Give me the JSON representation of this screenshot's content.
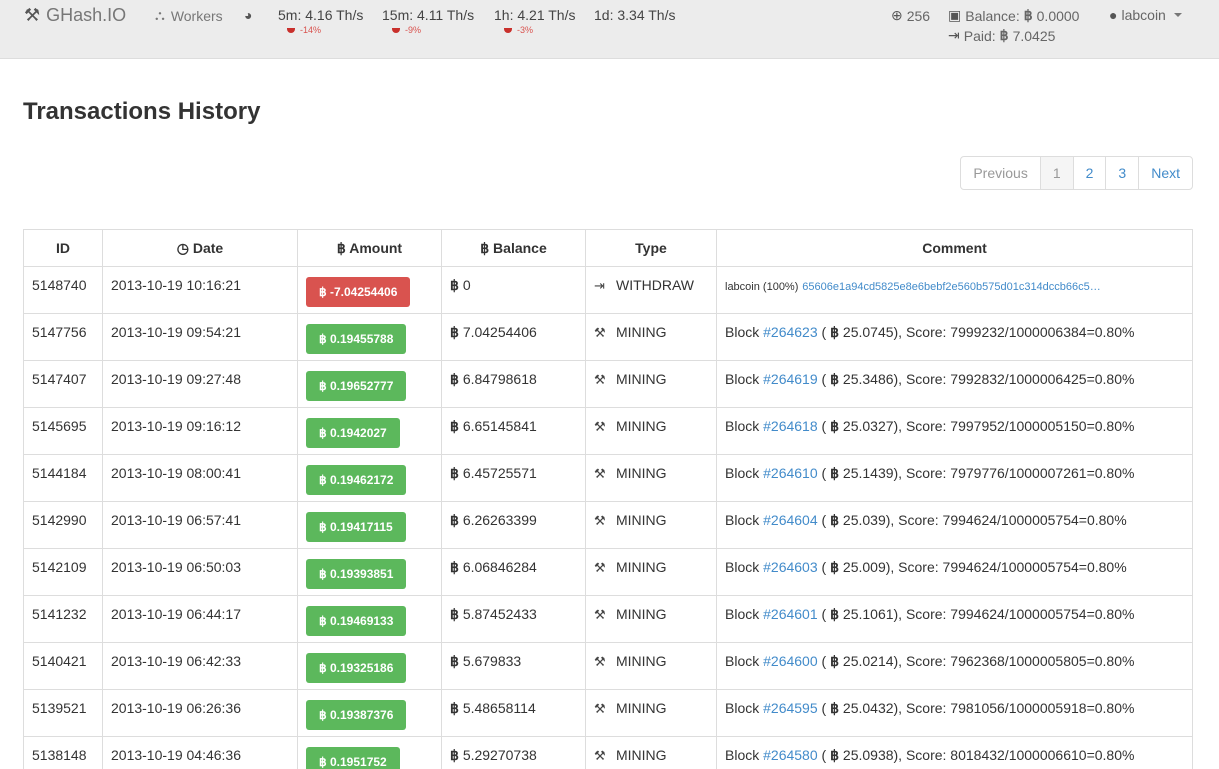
{
  "header": {
    "brand": "GHash.IO",
    "workers_label": "Workers",
    "rates": [
      {
        "label": "5m: 4.16 Th/s",
        "delta": "-14%"
      },
      {
        "label": "15m: 4.11 Th/s",
        "delta": "-9%"
      },
      {
        "label": "1h: 4.21 Th/s",
        "delta": "-3%"
      },
      {
        "label": "1d: 3.34 Th/s",
        "delta": ""
      }
    ],
    "difficulty": "256",
    "balance_label": "Balance:",
    "balance_value": "0.0000",
    "paid_label": "Paid:",
    "paid_value": "7.0425",
    "user": "labcoin"
  },
  "page_title": "Transactions History",
  "pagination": {
    "previous": "Previous",
    "pages": [
      "1",
      "2",
      "3"
    ],
    "next": "Next",
    "active": "1"
  },
  "table": {
    "headers": {
      "id": "ID",
      "date": "Date",
      "amount": "Amount",
      "balance": "Balance",
      "type": "Type",
      "comment": "Comment"
    },
    "rows": [
      {
        "id": "5148740",
        "date": "2013-10-19 10:16:21",
        "amount": "-7.04254406",
        "balance": "0",
        "type": "WITHDRAW",
        "withdraw": true,
        "comment_prefix": "labcoin (100%)",
        "link": "65606e1a94cd5825e8e6bebf2e560b575d01c314dccb66c5…"
      },
      {
        "id": "5147756",
        "date": "2013-10-19 09:54:21",
        "amount": "0.19455788",
        "balance": "7.04254406",
        "type": "MINING",
        "block": "#264623",
        "reward": "25.0745",
        "score": "), Score: 7999232/1000006384=0.80%"
      },
      {
        "id": "5147407",
        "date": "2013-10-19 09:27:48",
        "amount": "0.19652777",
        "balance": "6.84798618",
        "type": "MINING",
        "block": "#264619",
        "reward": "25.3486",
        "score": "), Score: 7992832/1000006425=0.80%"
      },
      {
        "id": "5145695",
        "date": "2013-10-19 09:16:12",
        "amount": "0.1942027",
        "balance": "6.65145841",
        "type": "MINING",
        "block": "#264618",
        "reward": "25.0327",
        "score": "), Score: 7997952/1000005150=0.80%"
      },
      {
        "id": "5144184",
        "date": "2013-10-19 08:00:41",
        "amount": "0.19462172",
        "balance": "6.45725571",
        "type": "MINING",
        "block": "#264610",
        "reward": "25.1439",
        "score": "), Score: 7979776/1000007261=0.80%"
      },
      {
        "id": "5142990",
        "date": "2013-10-19 06:57:41",
        "amount": "0.19417115",
        "balance": "6.26263399",
        "type": "MINING",
        "block": "#264604",
        "reward": "25.039",
        "score": "), Score: 7994624/1000005754=0.80%"
      },
      {
        "id": "5142109",
        "date": "2013-10-19 06:50:03",
        "amount": "0.19393851",
        "balance": "6.06846284",
        "type": "MINING",
        "block": "#264603",
        "reward": "25.009",
        "score": "), Score: 7994624/1000005754=0.80%"
      },
      {
        "id": "5141232",
        "date": "2013-10-19 06:44:17",
        "amount": "0.19469133",
        "balance": "5.87452433",
        "type": "MINING",
        "block": "#264601",
        "reward": "25.1061",
        "score": "), Score: 7994624/1000005754=0.80%"
      },
      {
        "id": "5140421",
        "date": "2013-10-19 06:42:33",
        "amount": "0.19325186",
        "balance": "5.679833",
        "type": "MINING",
        "block": "#264600",
        "reward": "25.0214",
        "score": "), Score: 7962368/1000005805=0.80%"
      },
      {
        "id": "5139521",
        "date": "2013-10-19 06:26:36",
        "amount": "0.19387376",
        "balance": "5.48658114",
        "type": "MINING",
        "block": "#264595",
        "reward": "25.0432",
        "score": "), Score: 7981056/1000005918=0.80%"
      },
      {
        "id": "5138148",
        "date": "2013-10-19 04:46:36",
        "amount": "0.1951752",
        "balance": "5.29270738",
        "type": "MINING",
        "block": "#264580",
        "reward": "25.0938",
        "score": "), Score: 8018432/1000006610=0.80%"
      }
    ]
  },
  "labels": {
    "block_word": "Block",
    "open_paren": " ( "
  },
  "colors": {
    "positive": "#5cb85c",
    "negative": "#d9534f",
    "link": "#428bca"
  }
}
